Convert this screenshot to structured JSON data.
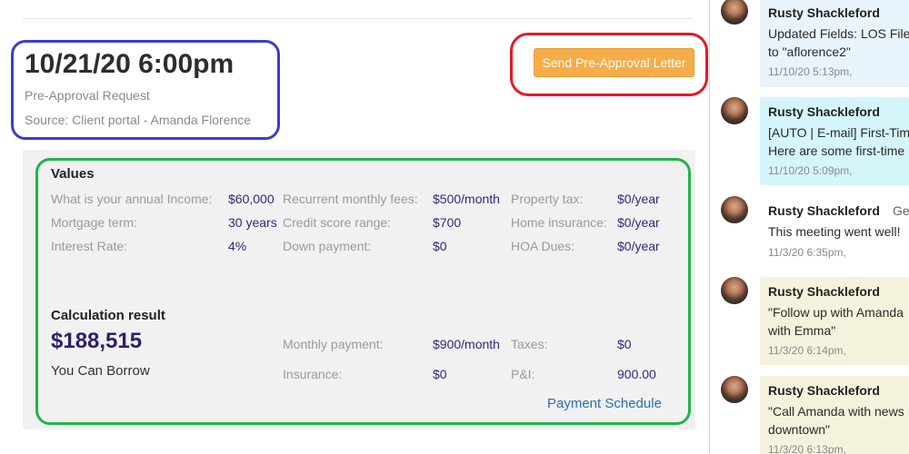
{
  "event": {
    "datetime": "10/21/20 6:00pm",
    "type": "Pre-Approval Request",
    "source": "Source: Client portal - Amanda Florence"
  },
  "actions": {
    "send_letter_label": "Send Pre-Approval Letter"
  },
  "values": {
    "title": "Values",
    "fields": [
      {
        "label": "What is your annual Income:",
        "value": "$60,000"
      },
      {
        "label": "Mortgage term:",
        "value": "30 years"
      },
      {
        "label": "Interest Rate:",
        "value": "4%"
      },
      {
        "label": "Recurrent monthly fees:",
        "value": "$500/month"
      },
      {
        "label": "Credit score range:",
        "value": "$700"
      },
      {
        "label": "Down payment:",
        "value": "$0"
      },
      {
        "label": "Property tax:",
        "value": "$0/year"
      },
      {
        "label": "Home insurance:",
        "value": "$0/year"
      },
      {
        "label": "HOA Dues:",
        "value": "$0/year"
      }
    ]
  },
  "calculation": {
    "title": "Calculation result",
    "amount": "$188,515",
    "amount_label": "You Can Borrow",
    "fields": [
      {
        "label": "Monthly payment:",
        "value": "$900/month"
      },
      {
        "label": "Insurance:",
        "value": "$0"
      },
      {
        "label": "Taxes:",
        "value": "$0"
      },
      {
        "label": "P&I:",
        "value": "900.00"
      }
    ],
    "schedule_link": "Payment Schedule"
  },
  "activity": {
    "items": [
      {
        "author": "Rusty Shackleford",
        "extra": "",
        "lines": [
          "Updated Fields: LOS File",
          "to \"aflorence2\""
        ],
        "time": "11/10/20 5:13pm,",
        "bg": "#e8f3fb"
      },
      {
        "author": "Rusty Shackleford",
        "extra": "",
        "lines": [
          "[AUTO | E-mail] First-Tim",
          "Here are some first-time"
        ],
        "time": "11/10/20 5:09pm,",
        "bg": "#d4f6fb"
      },
      {
        "author": "Rusty Shackleford",
        "extra": "Ge",
        "lines": [
          "This meeting went well!"
        ],
        "time": "11/3/20 6:35pm,",
        "bg": "#ffffff"
      },
      {
        "author": "Rusty Shackleford",
        "extra": "",
        "lines": [
          "\"Follow up with Amanda",
          "with Emma\""
        ],
        "time": "11/3/20 6:14pm,",
        "bg": "#f4f2dc"
      },
      {
        "author": "Rusty Shackleford",
        "extra": "",
        "lines": [
          "\"Call Amanda with news",
          "downtown\""
        ],
        "time": "11/3/20 6:13pm,",
        "bg": "#f4f2dc"
      }
    ]
  }
}
